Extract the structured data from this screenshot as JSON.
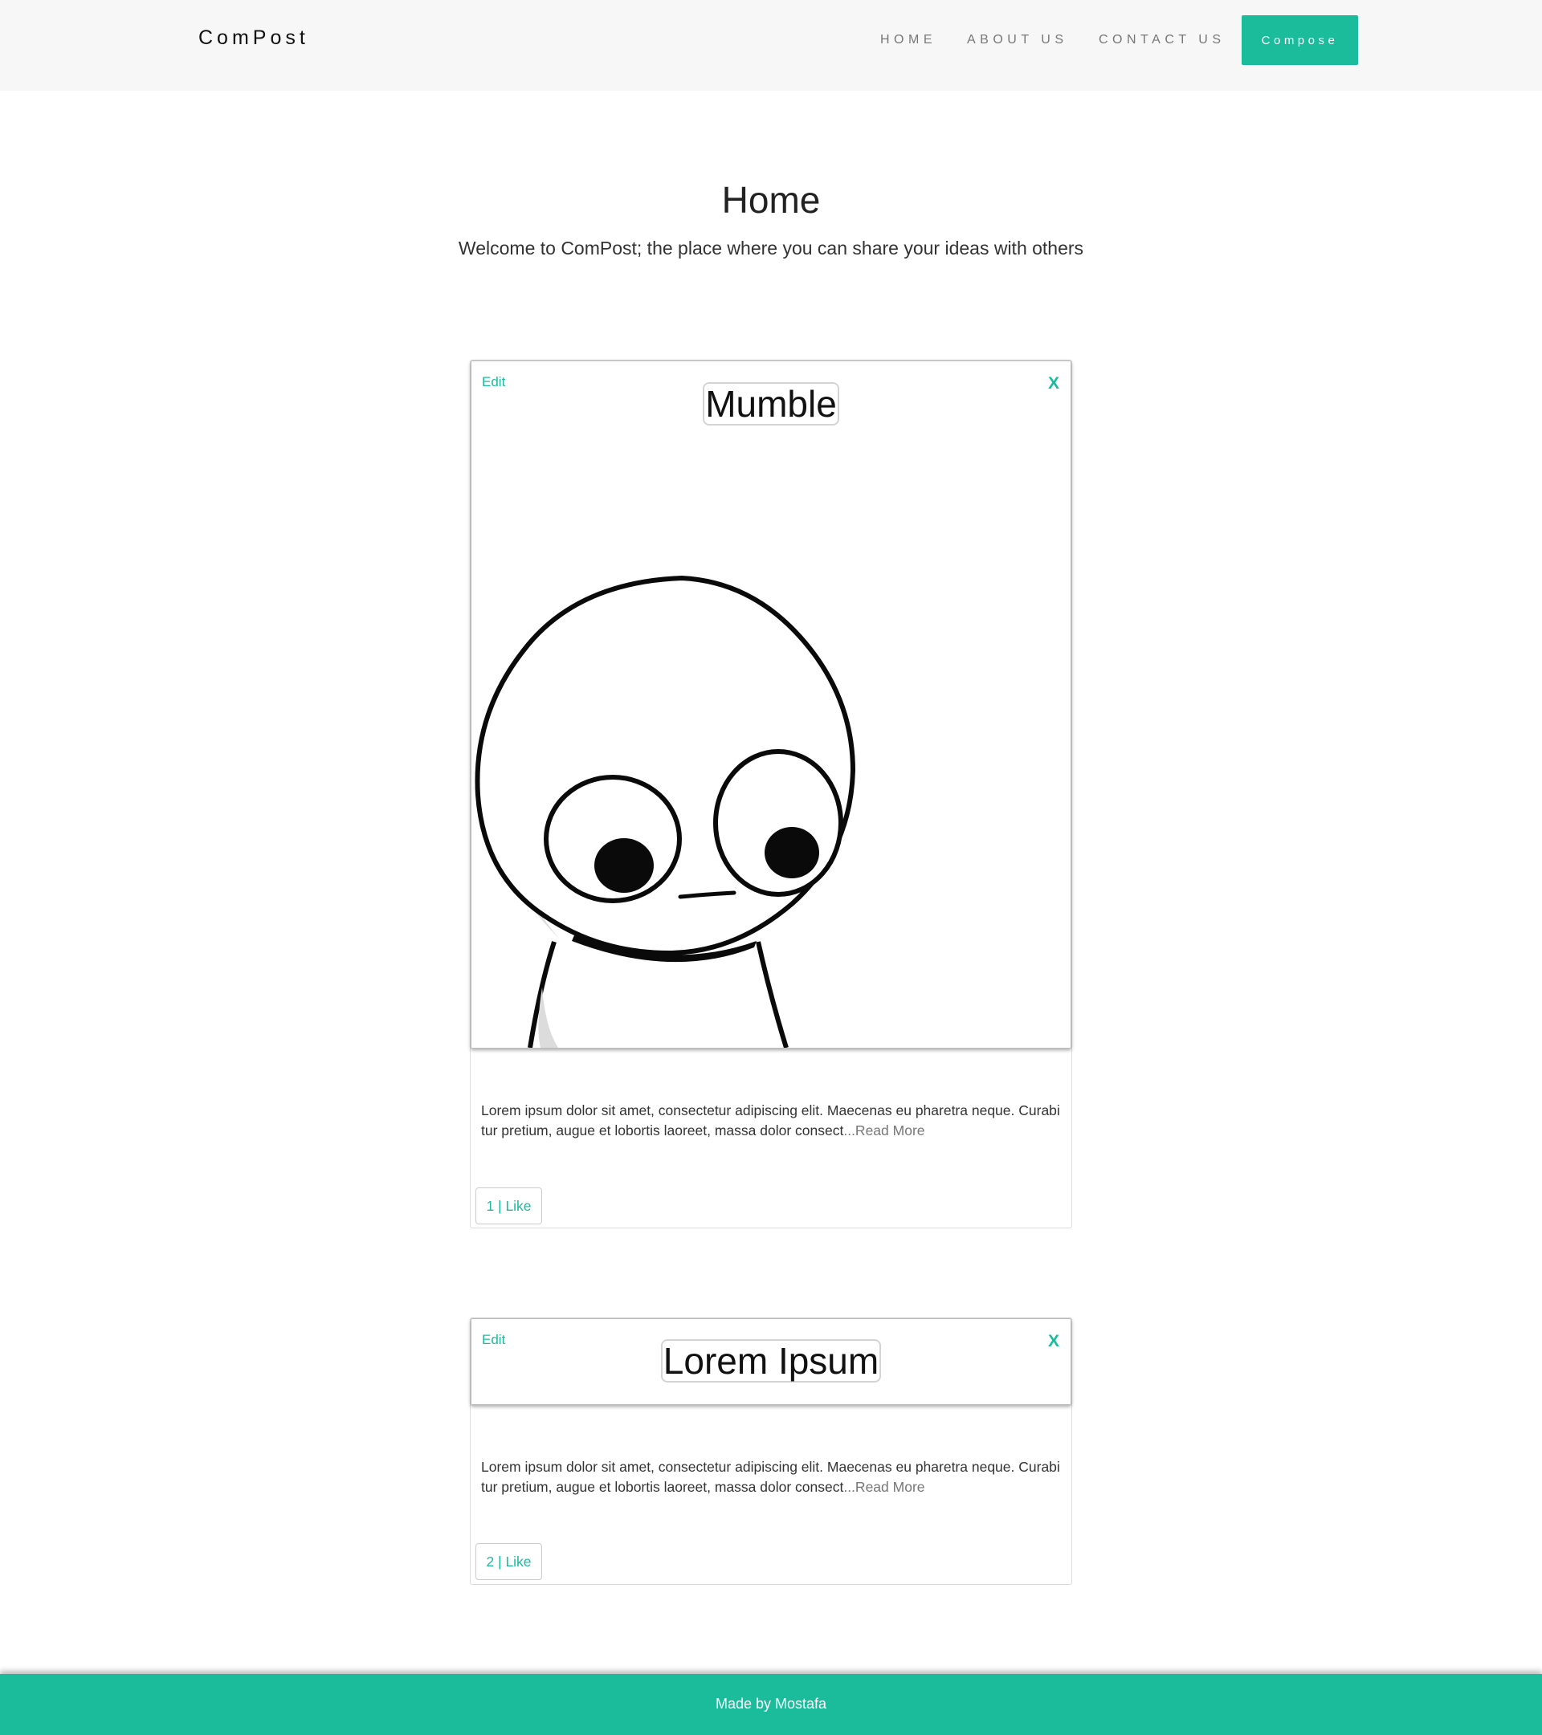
{
  "navbar": {
    "brand": "ComPost",
    "links": [
      "HOME",
      "ABOUT US",
      "CONTACT US"
    ],
    "compose_label": "Compose"
  },
  "header": {
    "title": "Home",
    "subtitle": "Welcome to ComPost; the place where you can share your ideas with others"
  },
  "posts": [
    {
      "edit_label": "Edit",
      "close_label": "X",
      "title": "Mumble",
      "excerpt": "Lorem ipsum dolor sit amet, consectetur adipiscing elit. Maecenas eu pharetra neque. Curabi tur pretium, augue et lobortis laoreet, massa dolor consect",
      "read_more": "...Read More",
      "like_label": "1 | Like"
    },
    {
      "edit_label": "Edit",
      "close_label": "X",
      "title": "Lorem Ipsum",
      "excerpt": "Lorem ipsum dolor sit amet, consectetur adipiscing elit. Maecenas eu pharetra neque. Curabi tur pretium, augue et lobortis laoreet, massa dolor consect",
      "read_more": "...Read More",
      "like_label": "2 | Like"
    }
  ],
  "footer": {
    "text": "Made by Mostafa"
  },
  "colors": {
    "accent": "#1abc9c",
    "navbar_bg": "#f7f7f7"
  }
}
